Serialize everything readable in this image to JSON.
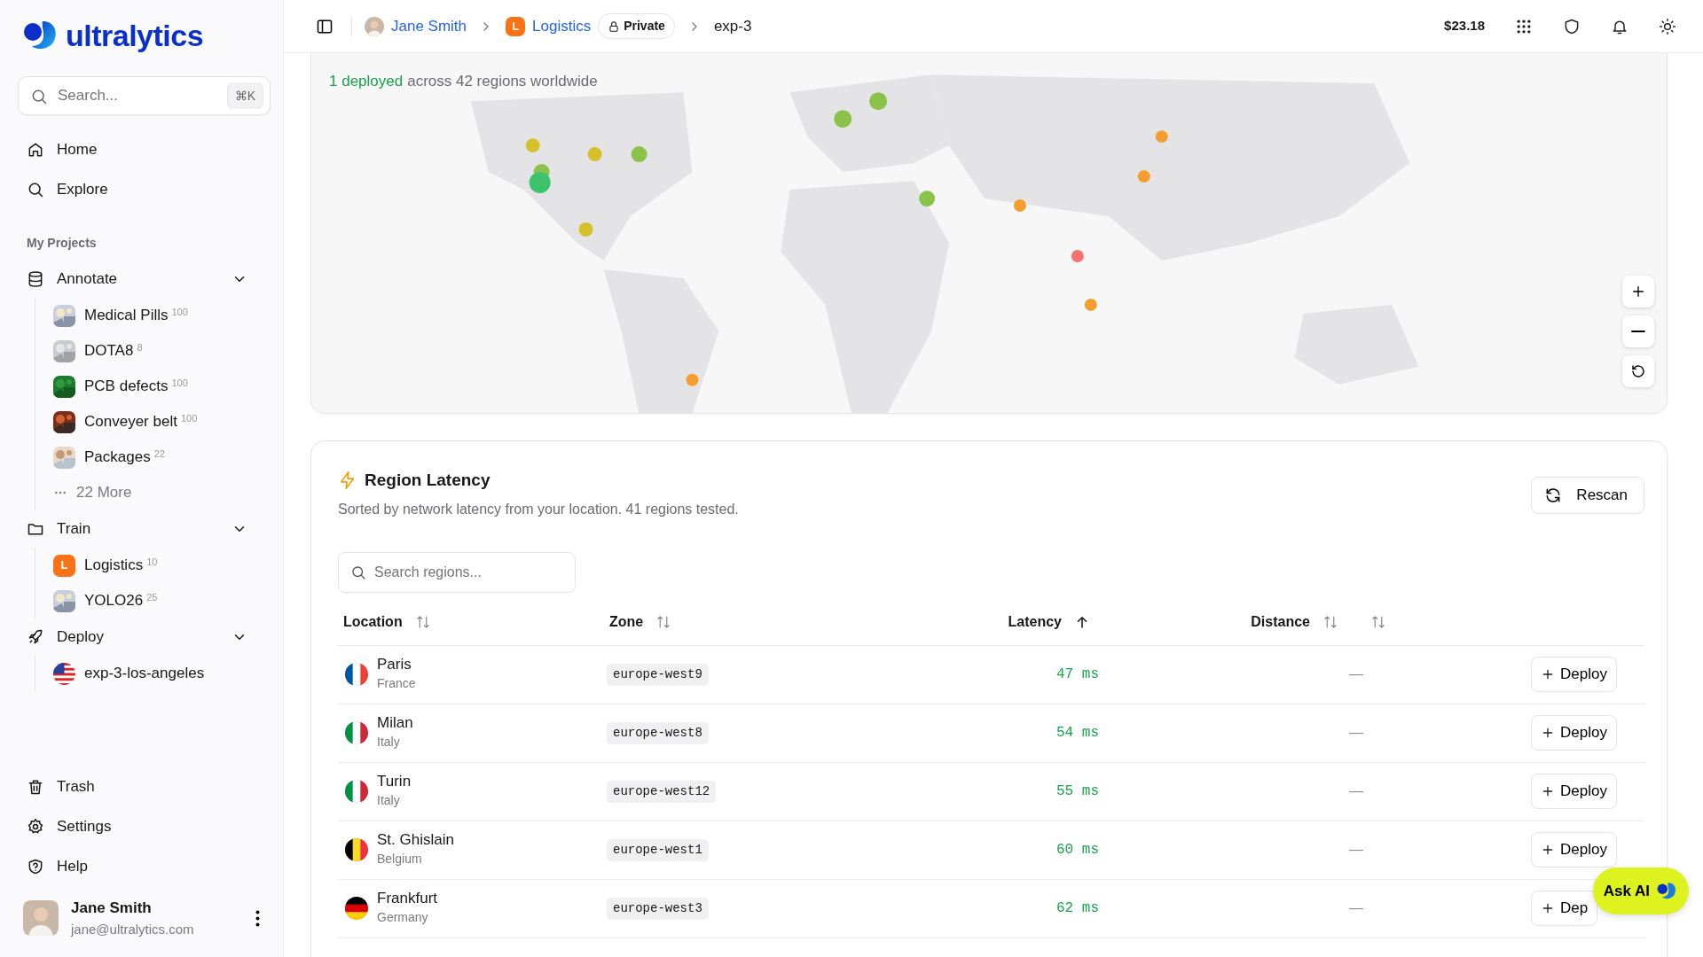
{
  "brand": {
    "name": "ultralytics"
  },
  "search": {
    "placeholder": "Search...",
    "shortcut": "⌘K"
  },
  "nav": [
    {
      "label": "Home"
    },
    {
      "label": "Explore"
    }
  ],
  "projects": {
    "heading": "My Projects",
    "groups": [
      {
        "label": "Annotate",
        "expanded": true,
        "items": [
          {
            "kind": "picture",
            "label": "Medical Pills",
            "count": "100"
          },
          {
            "kind": "picture",
            "label": "DOTA8",
            "count": "8"
          },
          {
            "kind": "picture",
            "label": "PCB defects",
            "count": "100"
          },
          {
            "kind": "picture",
            "label": "Conveyer belt",
            "count": "100"
          },
          {
            "kind": "picture",
            "label": "Packages",
            "count": "22"
          }
        ],
        "more": "22 More"
      },
      {
        "label": "Train",
        "expanded": true,
        "items": [
          {
            "kind": "letter",
            "badge": "L",
            "label": "Logistics",
            "count": "10"
          },
          {
            "kind": "picture",
            "label": "YOLO26",
            "count": "25"
          }
        ]
      },
      {
        "label": "Deploy",
        "expanded": true,
        "items": [
          {
            "kind": "flag",
            "label": "exp-3-los-angeles"
          }
        ]
      }
    ]
  },
  "bottom_nav": [
    {
      "label": "Trash"
    },
    {
      "label": "Settings"
    },
    {
      "label": "Help"
    }
  ],
  "user": {
    "name": "Jane Smith",
    "email": "jane@ultralytics.com"
  },
  "breadcrumb": [
    {
      "kind": "user",
      "label": "Jane Smith"
    },
    {
      "kind": "project",
      "badge": "L",
      "label": "Logistics",
      "tag": "Private"
    },
    {
      "kind": "page",
      "label": "exp-3"
    }
  ],
  "balance": "$23.18",
  "map": {
    "deployed": "1 deployed",
    "summary": "across 42 regions worldwide"
  },
  "latency": {
    "title": "Region Latency",
    "subtitle": "Sorted by network latency from your location. 41 regions tested.",
    "rescan": "Rescan",
    "search_placeholder": "Search regions...",
    "columns": [
      {
        "label": "Location",
        "sorted": false
      },
      {
        "label": "Zone",
        "sorted": false
      },
      {
        "label": "Latency",
        "sorted": true
      },
      {
        "label": "Distance",
        "sorted": false
      },
      {
        "sorted": false
      }
    ],
    "rows": [
      {
        "city": "Paris",
        "country": "France",
        "zone": "europe-west9",
        "latency": "47 ms",
        "distance": "—",
        "action": "Deploy"
      },
      {
        "city": "Milan",
        "country": "Italy",
        "zone": "europe-west8",
        "latency": "54 ms",
        "distance": "—",
        "action": "Deploy"
      },
      {
        "city": "Turin",
        "country": "Italy",
        "zone": "europe-west12",
        "latency": "55 ms",
        "distance": "—",
        "action": "Deploy"
      },
      {
        "city": "St. Ghislain",
        "country": "Belgium",
        "zone": "europe-west1",
        "latency": "60 ms",
        "distance": "—",
        "action": "Deploy"
      },
      {
        "city": "Frankfurt",
        "country": "Germany",
        "zone": "europe-west3",
        "latency": "62 ms",
        "distance": "—",
        "action": "Dep"
      }
    ]
  },
  "assistant": {
    "label": "Ask AI"
  }
}
